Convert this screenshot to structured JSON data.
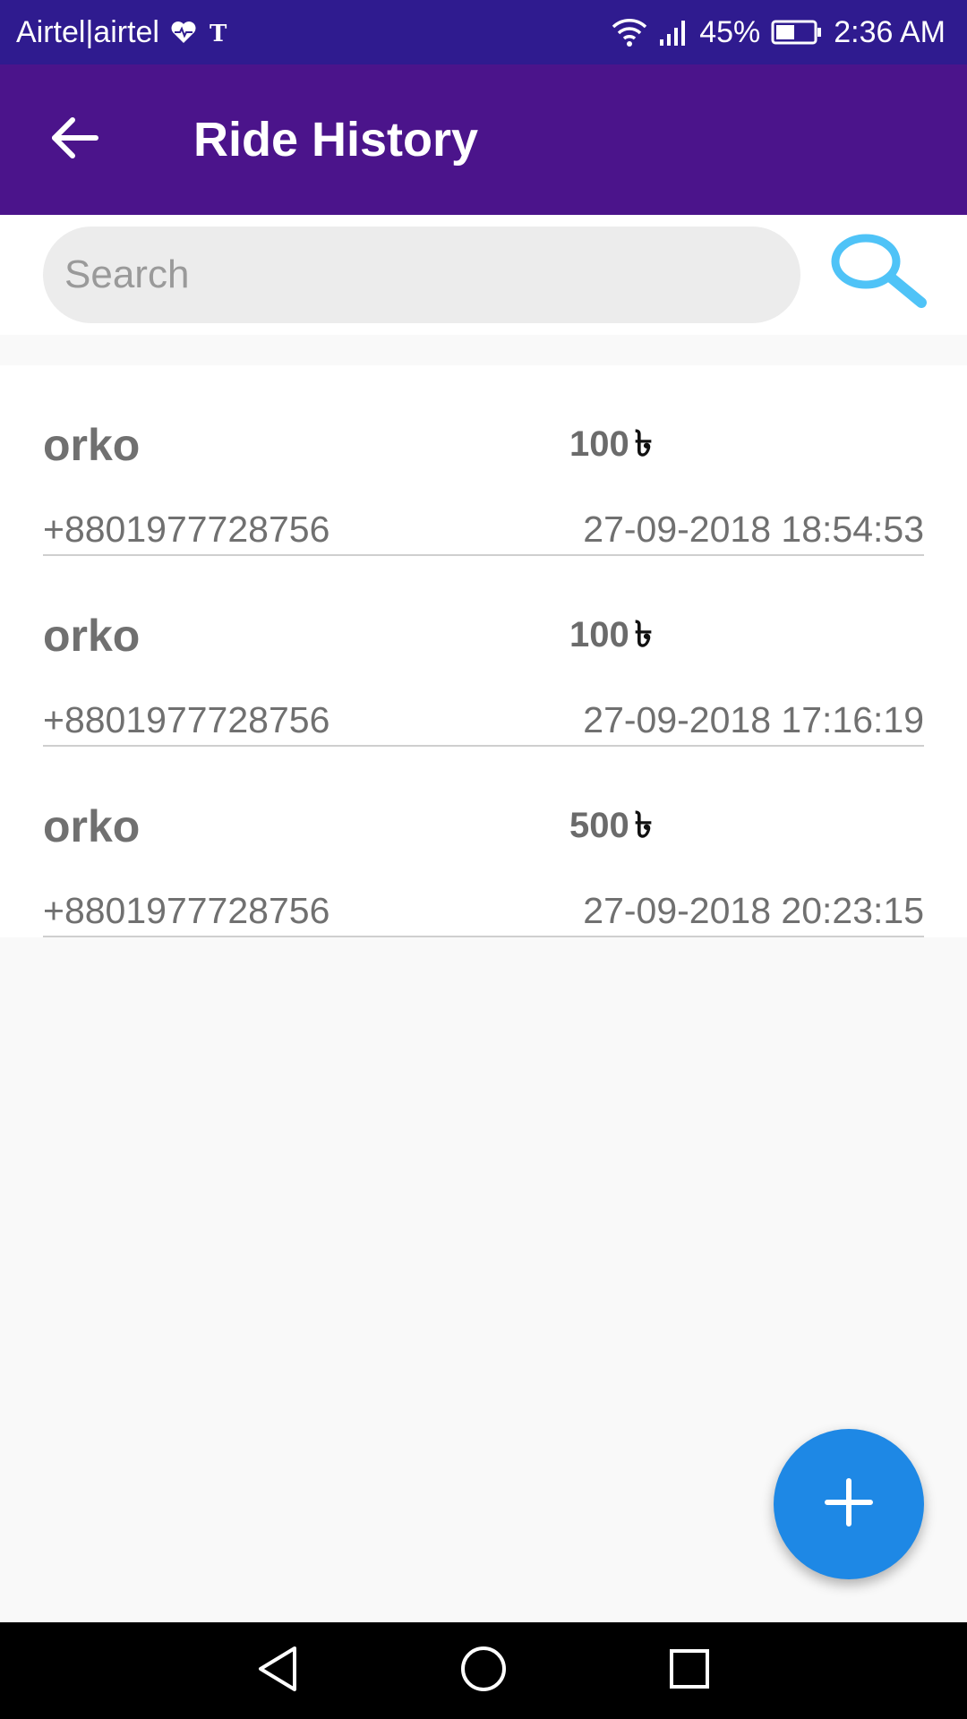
{
  "status_bar": {
    "carrier": "Airtel|airtel",
    "battery_percent": "45%",
    "time": "2:36 AM",
    "icons": [
      "heart-health-icon",
      "nytimes-icon",
      "wifi-icon",
      "signal-icon",
      "battery-icon"
    ]
  },
  "app_bar": {
    "title": "Ride History",
    "back_icon": "arrow-left-icon"
  },
  "search": {
    "placeholder": "Search",
    "value": "",
    "icon": "search-icon"
  },
  "rides": [
    {
      "name": "orko",
      "fare": "100",
      "currency": "৳",
      "phone": "+8801977728756",
      "datetime": "27-09-2018 18:54:53"
    },
    {
      "name": "orko",
      "fare": "100",
      "currency": "৳",
      "phone": "+8801977728756",
      "datetime": "27-09-2018 17:16:19"
    },
    {
      "name": "orko",
      "fare": "500",
      "currency": "৳",
      "phone": "+8801977728756",
      "datetime": "27-09-2018 20:23:15"
    }
  ],
  "fab": {
    "icon": "plus-icon"
  },
  "nav_bar": {
    "icons": [
      "back-triangle-icon",
      "home-circle-icon",
      "recents-square-icon"
    ]
  },
  "colors": {
    "status_bar": "#2f1b8f",
    "app_bar": "#4b148b",
    "accent": "#1e88e5",
    "search_icon": "#4fc3f7"
  }
}
